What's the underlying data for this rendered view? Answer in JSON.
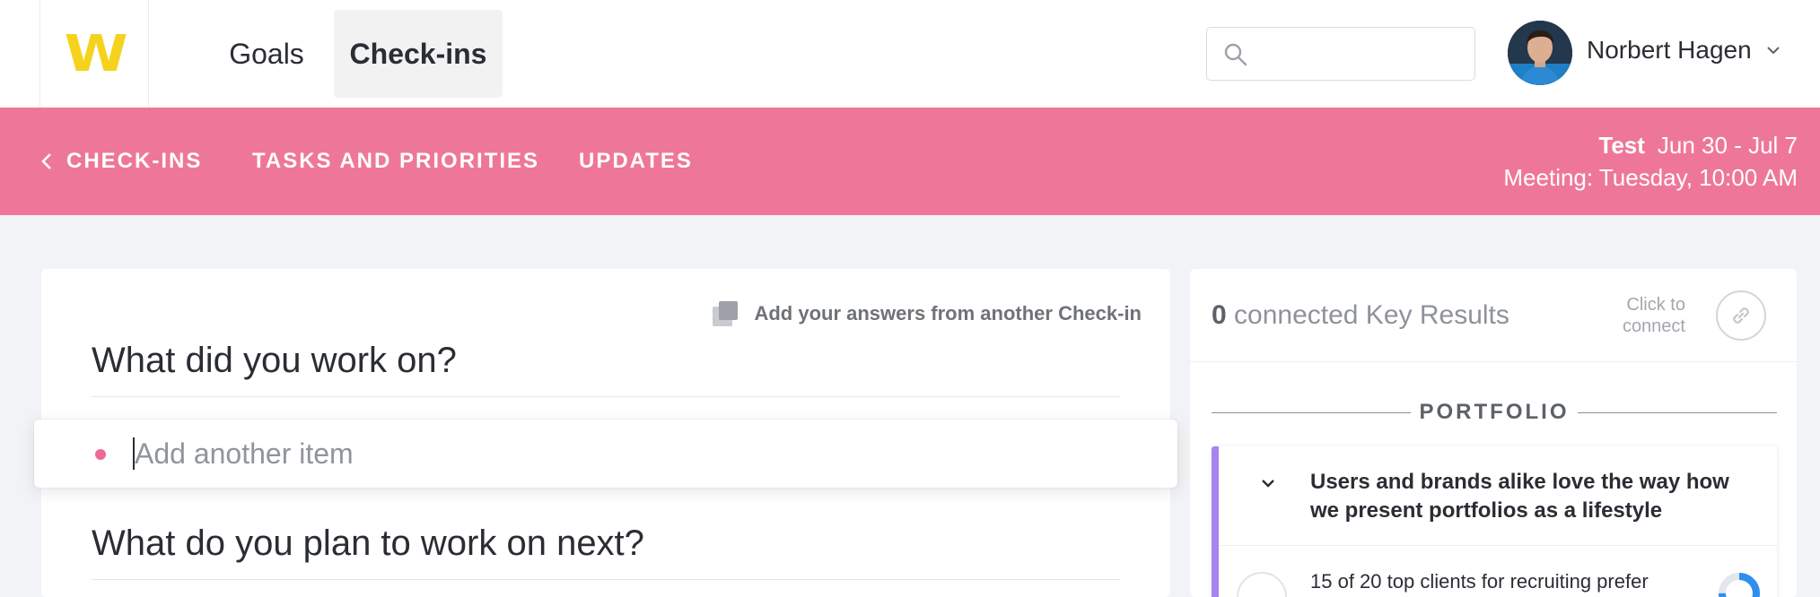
{
  "app": {
    "logo_text": "W",
    "brand_color": "#f5d21d",
    "accent_color": "#ee7799"
  },
  "nav": {
    "tabs": [
      {
        "label": "Goals",
        "active": false
      },
      {
        "label": "Check-ins",
        "active": true
      }
    ]
  },
  "search": {
    "placeholder": "",
    "value": "",
    "icon": "search-icon"
  },
  "user": {
    "name": "Norbert Hagen",
    "avatar_icon": "user-avatar",
    "menu_icon": "chevron-down-icon"
  },
  "subnav": {
    "back_label": "CHECK-INS",
    "back_icon": "chevron-left-icon",
    "tasks_label": "TASKS AND PRIORITIES",
    "updates_label": "UPDATES",
    "checkin_name": "Test",
    "date_range": "Jun 30 - Jul 7",
    "meeting": "Meeting: Tuesday, 10:00 AM"
  },
  "main": {
    "add_from_other_label": "Add your answers from another Check-in",
    "add_from_other_icon": "copy-icon",
    "question_1": "What did you work on?",
    "add_item_placeholder": "Add another item",
    "question_2": "What do you plan to work on next?"
  },
  "side": {
    "connected_count": "0",
    "connected_label": "connected Key Results",
    "click_to_connect": "Click to connect",
    "link_icon": "link-icon",
    "section_label": "PORTFOLIO",
    "goal": {
      "title": "Users and brands alike love the way how we present portfolios as a lifestyle",
      "accent_color": "#a585ee",
      "key_result": {
        "text": "15 of 20 top clients for recruiting prefer",
        "progress": 0.75,
        "progress_color": "#2f8fee"
      }
    }
  }
}
